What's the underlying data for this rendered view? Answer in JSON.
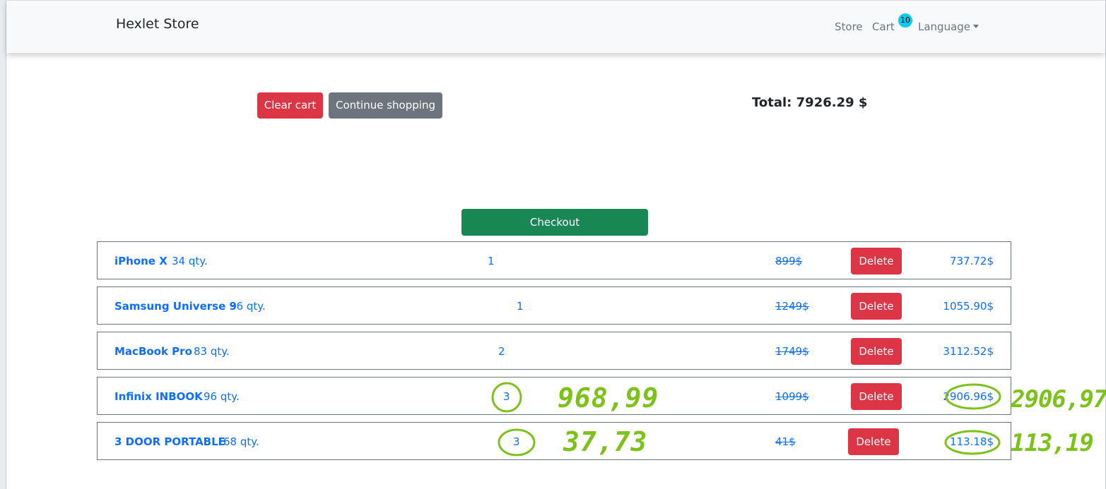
{
  "navbar": {
    "brand": "Hexlet Store",
    "store": "Store",
    "cart": "Cart",
    "cart_count": "10",
    "language": "Language"
  },
  "actions": {
    "clear_cart": "Clear cart",
    "continue_shopping": "Continue shopping",
    "total": "Total: 7926.29 $",
    "checkout": "Checkout"
  },
  "cart": {
    "items": [
      {
        "name": "iPhone X",
        "stock": "34 qty.",
        "count": "1",
        "old_price": "899$",
        "delete": "Delete",
        "sum": "737.72$"
      },
      {
        "name": "Samsung Universe 9",
        "stock": "36 qty.",
        "count": "1",
        "old_price": "1249$",
        "delete": "Delete",
        "sum": "1055.90$"
      },
      {
        "name": "MacBook Pro",
        "stock": "83 qty.",
        "count": "2",
        "old_price": "1749$",
        "delete": "Delete",
        "sum": "3112.52$"
      },
      {
        "name": "Infinix INBOOK",
        "stock": "96 qty.",
        "count": "3",
        "old_price": "1099$",
        "delete": "Delete",
        "sum": "2906.96$"
      },
      {
        "name": "3 DOOR PORTABLE",
        "stock": "68 qty.",
        "count": "3",
        "old_price": "41$",
        "delete": "Delete",
        "sum": "113.18$"
      }
    ]
  },
  "handwritten_notes": {
    "row4_unit": "968,99",
    "row4_total": "2906,97",
    "row5_unit": "37,73",
    "row5_total": "113,19",
    "color": "#7cc21a"
  }
}
